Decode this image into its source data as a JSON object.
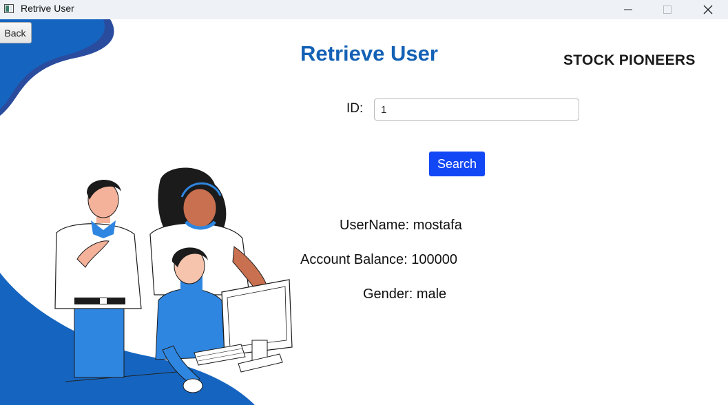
{
  "window": {
    "title": "Retrive User",
    "controls": [
      "minimize",
      "maximize",
      "close"
    ]
  },
  "nav": {
    "back_label": "Back"
  },
  "page": {
    "title": "Retrieve User",
    "brand": "STOCK PIONEERS"
  },
  "form": {
    "id_label": "ID:",
    "id_value": "1",
    "search_label": "Search"
  },
  "result": {
    "username_line": "UserName: mostafa",
    "balance_line": "Account Balance: 100000",
    "gender_line": "Gender: male"
  },
  "colors": {
    "accent": "#1361b5",
    "button": "#1147f4",
    "decor_blue": "#1565c0",
    "shirt_blue": "#2f86e0"
  },
  "icons": [
    "app-icon",
    "minimize-icon",
    "maximize-icon",
    "close-icon"
  ]
}
